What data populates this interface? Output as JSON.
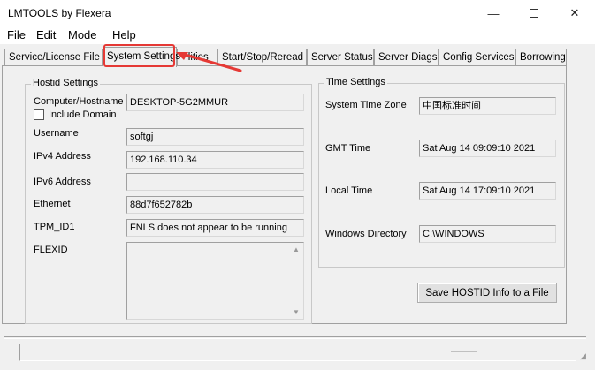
{
  "window": {
    "title": "LMTOOLS by Flexera",
    "controls": {
      "minimize": "—",
      "close": "✕"
    }
  },
  "menu": [
    "File",
    "Edit",
    "Mode",
    "Help"
  ],
  "tabs": [
    {
      "label": "Service/License File",
      "active": false
    },
    {
      "label": "System Settings",
      "active": true
    },
    {
      "label": "ilities",
      "active": false
    },
    {
      "label": "Start/Stop/Reread",
      "active": false
    },
    {
      "label": "Server Status",
      "active": false
    },
    {
      "label": "Server Diags",
      "active": false
    },
    {
      "label": "Config Services",
      "active": false
    },
    {
      "label": "Borrowing",
      "active": false
    }
  ],
  "hostid": {
    "legend": "Hostid Settings",
    "computer_label": "Computer/Hostname",
    "computer_value": "DESKTOP-5G2MMUR",
    "include_domain_label": "Include Domain",
    "include_domain_checked": false,
    "username_label": "Username",
    "username_value": "softgj",
    "ipv4_label": "IPv4 Address",
    "ipv4_value": "192.168.110.34",
    "ipv6_label": "IPv6 Address",
    "ipv6_value": "",
    "ethernet_label": "Ethernet",
    "ethernet_value": "88d7f652782b",
    "tpm_label": "TPM_ID1",
    "tpm_value": "FNLS does not appear to be running",
    "flexid_label": "FLEXID"
  },
  "time": {
    "legend": "Time Settings",
    "zone_label": "System Time Zone",
    "zone_value": "中国标准时间",
    "gmt_label": "GMT Time",
    "gmt_value": "Sat Aug 14 09:09:10 2021",
    "local_label": "Local Time",
    "local_value": "Sat Aug 14 17:09:10 2021",
    "windir_label": "Windows Directory",
    "windir_value": "C:\\WINDOWS"
  },
  "save_button": "Save HOSTID Info to a File",
  "colors": {
    "highlight": "#e53935"
  }
}
